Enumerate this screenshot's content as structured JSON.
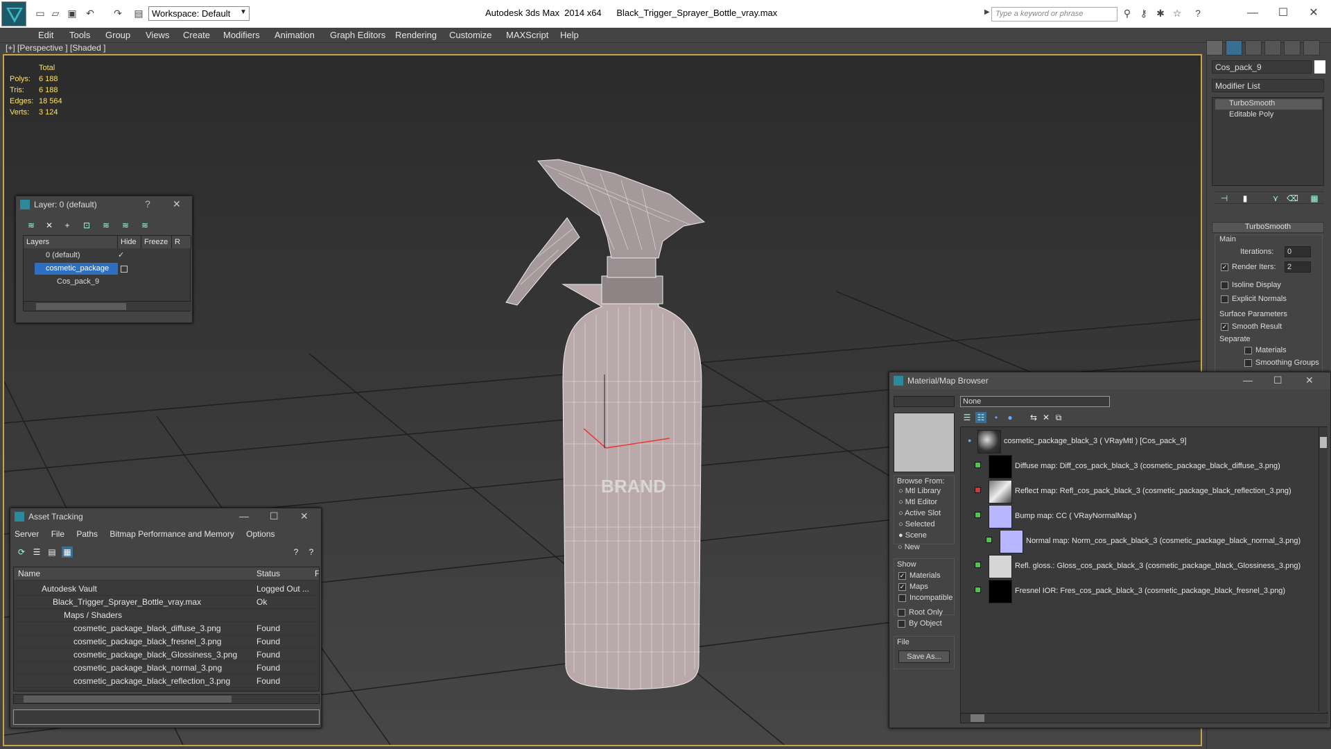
{
  "window": {
    "app_name": "Autodesk 3ds Max  2014 x64",
    "file_name": "Black_Trigger_Sprayer_Bottle_vray.max",
    "workspace": "Workspace: Default",
    "search_placeholder": "Type a keyword or phrase"
  },
  "menu": [
    "Edit",
    "Tools",
    "Group",
    "Views",
    "Create",
    "Modifiers",
    "Animation",
    "Graph Editors",
    "Rendering",
    "Customize",
    "MAXScript",
    "Help"
  ],
  "viewport": {
    "label": "[+] [Perspective ] [Shaded ]",
    "stats_header": "Total",
    "stats": [
      {
        "label": "Polys:",
        "value": "6 188"
      },
      {
        "label": "Tris:",
        "value": "6 188"
      },
      {
        "label": "Edges:",
        "value": "18 564"
      },
      {
        "label": "Verts:",
        "value": "3 124"
      }
    ],
    "bottle_text": "BRAND"
  },
  "command_panel": {
    "object_name": "Cos_pack_9",
    "modifier_list": "Modifier List",
    "stack": [
      "TurboSmooth",
      "Editable Poly"
    ],
    "rollout_title": "TurboSmooth",
    "main_label": "Main",
    "iterations_label": "Iterations:",
    "iterations_value": "0",
    "render_iters_label": "Render Iters:",
    "render_iters_value": "2",
    "isoline": "Isoline Display",
    "explicit": "Explicit Normals",
    "surface_params": "Surface Parameters",
    "smooth_result": "Smooth Result",
    "separate": "Separate",
    "materials": "Materials",
    "smoothing_groups": "Smoothing Groups"
  },
  "layer_window": {
    "title": "Layer: 0 (default)",
    "help": "?",
    "col_layers": "Layers",
    "col_hide": "Hide",
    "col_freeze": "Freeze",
    "col_r": "R",
    "rows": [
      {
        "name": "0 (default)"
      },
      {
        "name": "cosmetic_package"
      },
      {
        "name": "Cos_pack_9"
      }
    ]
  },
  "asset_window": {
    "title": "Asset Tracking",
    "menu": [
      "Server",
      "File",
      "Paths",
      "Bitmap Performance and Memory",
      "Options"
    ],
    "col_name": "Name",
    "col_status": "Status",
    "col_extra": "F",
    "rows": [
      {
        "name": "Autodesk Vault",
        "status": "Logged Out ..."
      },
      {
        "name": "Black_Trigger_Sprayer_Bottle_vray.max",
        "status": "Ok"
      },
      {
        "name": "Maps / Shaders",
        "status": ""
      },
      {
        "name": "cosmetic_package_black_diffuse_3.png",
        "status": "Found"
      },
      {
        "name": "cosmetic_package_black_fresnel_3.png",
        "status": "Found"
      },
      {
        "name": "cosmetic_package_black_Glossiness_3.png",
        "status": "Found"
      },
      {
        "name": "cosmetic_package_black_normal_3.png",
        "status": "Found"
      },
      {
        "name": "cosmetic_package_black_reflection_3.png",
        "status": "Found"
      }
    ]
  },
  "material_window": {
    "title": "Material/Map Browser",
    "filter": "None",
    "browse_from": "Browse From:",
    "browse_options": [
      "Mtl Library",
      "Mtl Editor",
      "Active Slot",
      "Selected",
      "Scene",
      "New"
    ],
    "show": "Show",
    "show_materials": "Materials",
    "show_maps": "Maps",
    "show_incompatible": "Incompatible",
    "root_only": "Root Only",
    "by_object": "By Object",
    "file": "File",
    "save_as": "Save As...",
    "tree": [
      {
        "text": "cosmetic_package_black_3  ( VRayMtl )  [Cos_pack_9]"
      },
      {
        "text": "Diffuse map: Diff_cos_pack_black_3 (cosmetic_package_black_diffuse_3.png)"
      },
      {
        "text": "Reflect map: Refl_cos_pack_black_3 (cosmetic_package_black_reflection_3.png)"
      },
      {
        "text": "Bump map: CC  ( VRayNormalMap )"
      },
      {
        "text": "Normal map: Norm_cos_pack_black_3 (cosmetic_package_black_normal_3.png)"
      },
      {
        "text": "Refl. gloss.: Gloss_cos_pack_black_3 (cosmetic_package_black_Glossiness_3.png)"
      },
      {
        "text": "Fresnel IOR: Fres_cos_pack_black_3 (cosmetic_package_black_fresnel_3.png)"
      }
    ]
  }
}
